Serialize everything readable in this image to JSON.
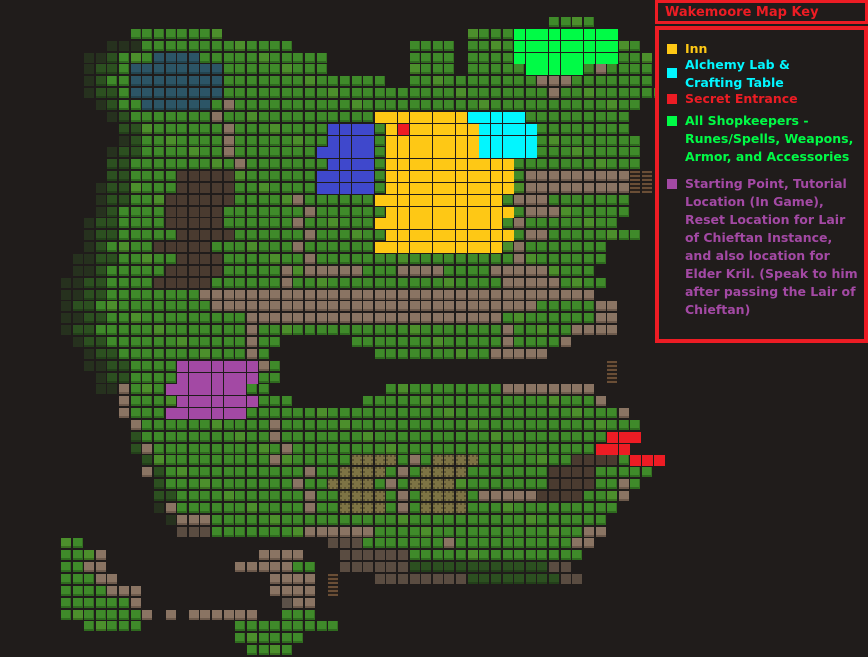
{
  "key": {
    "title": "Wakemoore Map Key",
    "border_color": "#ed1c24",
    "items": [
      {
        "label": "  Inn",
        "color": "#fec815",
        "icon": "inn-swatch"
      },
      {
        "label": "Alchemy Lab &\nCrafting Table",
        "color": "#02f6ff",
        "icon": "alchemy-swatch"
      },
      {
        "label": "Secret Entrance",
        "color": "#ed1c24",
        "icon": "secret-entrance-swatch"
      },
      {
        "label": "All Shopkeepers -\nRunes/Spells, Weapons,\nArmor, and Accessories",
        "color": "#00fb46",
        "icon": "shopkeepers-swatch"
      },
      {
        "label": "Starting Point, Tutorial\nLocation (In Game),\nReset Location for Lair\nof Chieftan Instance,\nand also location for\nElder Kril. (Speak to him\nafter passing the Lair of\nChieftan)",
        "color": "#a349a4",
        "icon": "starting-point-swatch"
      }
    ]
  },
  "map": {
    "legend_codes": {
      ".": "empty",
      "g": "grass",
      "d": "grass-dim",
      "e": "grass-faded",
      "p": "path",
      "q": "path-dim",
      "D": "dirt",
      "w": "water",
      "h": "crops",
      "s": "stairs",
      "x": "stone-block",
      "Y": "inn",
      "C": "alchemy-lab",
      "R": "secret-entrance",
      "G": "shopkeepers",
      "B": "blue-building",
      "P": "starting-point"
    },
    "rows": [
      "..........................................gggg....",
      "......gggggggg.....................ggggGGGGGGGGG...",
      "....eeeggggggggggggg..........gggg.ggggGGGGGGGGGgg.",
      "..eedgggwwwwggggggggggg.......gggg.ggggGGGGGGGGGggg",
      "..eddgwwwwwwwwggggggggg.......gggg.gggggGGGGGgpgggg",
      "..edggwwwwwwwwgggggggggggggg..gggggggggggpppggggggg",
      "..eddgwwwwwwwwggggggggggggggggggggggggggggpggggggggg",
      "...edggwwwwwwgpggggggggggggggggggggggggggggggggggg.",
      "....edgggggggpgggggggggggggYYYYYYYYCCCCCggggggggg..",
      ".....ddgggggggpggggggggBBBBgYRYYYYYYCCCCCgggggggg...",
      ".....edgggggggpggggggggBBBBgYYYYYYYYCCCCCggggggggg..",
      "....eddgggggggpgggggggBBBBBgYYYYYYYYCCCCCggggggggg..",
      "....ddgggggggggpgggggggBBBBgYYYYYYYYYYYggggggggggg..",
      "....ddggggDDDDDgggggggBBBBBgYYYYYYYYYYYgpppppppppss.",
      "...eddggggDDDDDgggggggBBBBBgYYYYYYYYYYYgpppppppppss.",
      "...eddgggDDDDDDgggggpggggggYYYYYYYYYYYgpppggggggg...",
      "...edggggDDDDDgggggggpggggggYYYYYYYYYYYgpppgggggg...",
      "..eddggggDDDDDggggggpggggggYYYYYYYYYYYgpgggggggg....",
      "..eddgggggDDDDDggggggpggggggYYYYYYYYYYYgppgggggggg...",
      "..edggggDDDDDgggggggpggggggYYYYYYYYYYYgpggggggg....",
      ".eeddgggggDDDDgggggggpgggggggggggggggggpggggggg.....",
      ".eedgggggDDDDDgggggpgpppppgggppppggggpppppgggg.....",
      "eeddggggDDDDDggggggpggggggggggggggggggpppppgggg....",
      "eeddggggggggpppppppppppppppppppppppppppppppppp.....",
      "eddggggggggggppppppppppppppppppppppppppppgggggpp...",
      "eeddggggggggggggppppppppppppppppppppppggggggggpp...",
      "eddgggggggggggggpgggggggggggggggggggggpgggggpppp...",
      ".eddggggggggggggpgg......gggggggggggggpggggp.......",
      "..eddgggggggggggpg.........ggggggggggppppp.........",
      "..eeddggggPPPPPPPpg............................s...",
      "...eddggggPPPPPPPgg............................s...",
      "...eepgggPPPPPPPgg..........ggggggggggpppppppp.....",
      ".....pggggPPPPPPPggg......ggggggggggggggggggggp.....",
      ".....pgggPPPPPPPggggggggggggggggggggggggggggggggp....",
      "......pgggggggggggpggggggggggggggggggggggggggggggg..",
      "......dgggggggggggpggggggggggggggggggggggggggggRRR..",
      "......dpgggggggggggpggggggggggggggggggggggggggRRR...",
      ".......dggggggggggpgggggghhhhgpghhhhggggggggDDDDgRRR",
      ".......pdggggggggggggpgghhhhgpghhhhgggggggDDDDggggg.",
      "........dgggggggggggpgghhhhgpghhhhggggggggDDDDggpg..",
      "........ddgggggggggggpgghhhhgpghhhhgpppppDDDDgggp...",
      "........epgggggggggggpgghhhhgpghhhhggggggggggggg....",
      ".........epppgggggggggggggggggggggggggggggggggg.....",
      "..........qqqggggggggppppppggggggggggggggggggpp.....",
      "gg.....................qqqgggggggpggggggggggpp......",
      "gggp.............pppp...qqqqqqggggggggggggggg.......",
      "ggpp...........pppppgg..qqqqqqddddddddddddqq........",
      "gggpp.............pppp.s...qqqqqqqqddddddddqq.......",
      "ggggppp...........pppp.s.......................",
      "ggggggp............xpp.........................",
      "gggggggp.p.pppppp..ggg..........................",
      "..ggggg........ggggggggg........................",
      "...............gggggg...........................",
      "................gggg............................"
    ]
  }
}
